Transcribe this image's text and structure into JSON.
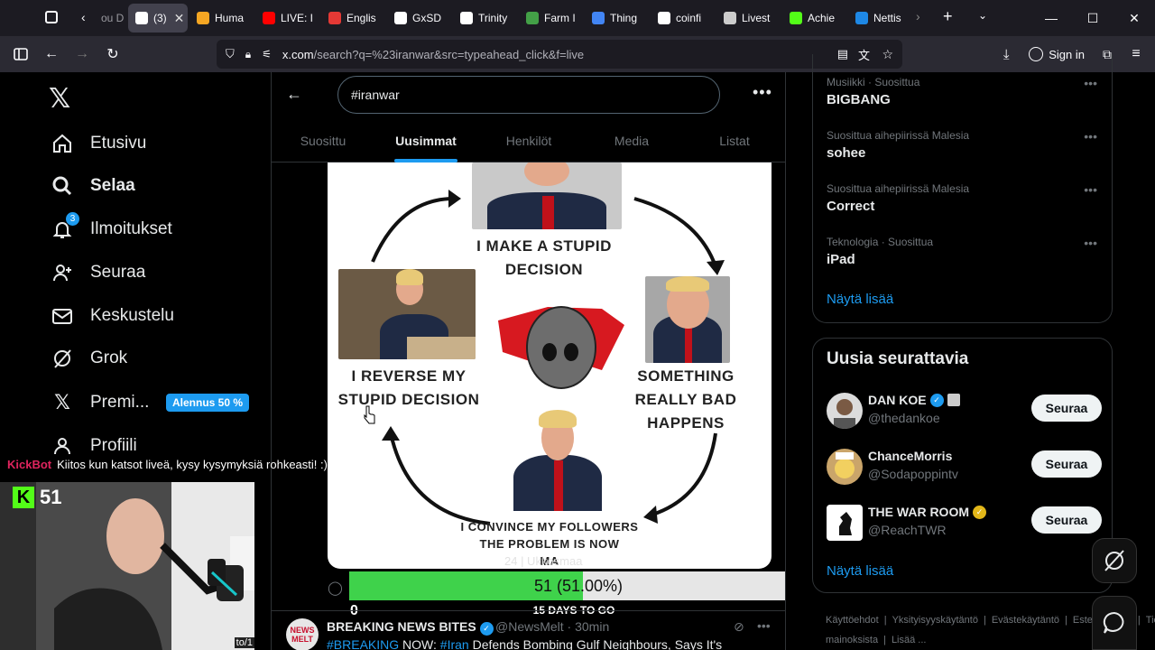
{
  "browser": {
    "tabs": [
      {
        "label": "ou D",
        "color": "#888888"
      },
      {
        "label": "(3)",
        "color": "#ffffff",
        "active": true
      },
      {
        "label": "Huma",
        "color": "#f5a623"
      },
      {
        "label": "LIVE: I",
        "color": "#ff0000"
      },
      {
        "label": "Englis",
        "color": "#e53935"
      },
      {
        "label": "GxSD",
        "color": "#ffffff"
      },
      {
        "label": "Trinity",
        "color": "#ffffff"
      },
      {
        "label": "Farm I",
        "color": "#43a047"
      },
      {
        "label": "Thing",
        "color": "#4285f4"
      },
      {
        "label": "coinfi",
        "color": "#ffffff"
      },
      {
        "label": "Livest",
        "color": "#cccccc"
      },
      {
        "label": "Achie",
        "color": "#53fc18"
      },
      {
        "label": "Nettis",
        "color": "#1e88e5"
      }
    ],
    "url_main": "x.com",
    "url_path": "/search?q=%23iranwar&src=typeahead_click&f=live",
    "signin": "Sign in"
  },
  "leftnav": {
    "items": [
      {
        "label": "Etusivu",
        "icon": "home-icon"
      },
      {
        "label": "Selaa",
        "icon": "search-icon",
        "bold": true
      },
      {
        "label": "Ilmoitukset",
        "icon": "bell-icon",
        "badge": "3"
      },
      {
        "label": "Seuraa",
        "icon": "person-add-icon"
      },
      {
        "label": "Keskustelu",
        "icon": "mail-icon"
      },
      {
        "label": "Grok",
        "icon": "grok-icon"
      },
      {
        "label": "Premi...",
        "icon": "x-logo-icon"
      },
      {
        "label": "Profiili",
        "icon": "person-icon"
      }
    ],
    "promo": "Alennus 50 %"
  },
  "search": {
    "query": "#iranwar",
    "tabs": [
      "Suosittu",
      "Uusimmat",
      "Henkilöt",
      "Media",
      "Listat"
    ],
    "active_tab": 1
  },
  "meme": {
    "top": "I MAKE A STUPID\nDECISION",
    "right": "SOMETHING\nREALLY BAD\nHAPPENS",
    "bottom": "I CONVINCE MY FOLLOWERS\nTHE PROBLEM IS NOW\nMA",
    "left": "I REVERSE MY\nSTUPID DECISION"
  },
  "overlay_caption": "24 | Ukkosmaa",
  "poll": {
    "text": "51 (51.00%)",
    "fraction": 0.51,
    "min": "0",
    "max": "100",
    "countdown": "15 DAYS TO GO",
    "fill_color": "#3fd24b"
  },
  "tweet2": {
    "avatar_text": "NEWS\nMELT",
    "name": "BREAKING NEWS BITES",
    "handle": "@NewsMelt · 30min",
    "tag1": "#BREAKING",
    "mid": " NOW: ",
    "tag2": "#Iran",
    "rest": " Defends Bombing Gulf Neighbours, Says It's"
  },
  "trends": [
    {
      "category": "Musiikki · Suosittua",
      "name": "BIGBANG"
    },
    {
      "category": "Suosittua aihepiirissä Malesia",
      "name": "sohee"
    },
    {
      "category": "Suosittua aihepiirissä Malesia",
      "name": "Correct"
    },
    {
      "category": "Teknologia · Suosittua",
      "name": "iPad"
    }
  ],
  "show_more": "Näytä lisää",
  "who_to_follow": {
    "title": "Uusia seurattavia",
    "users": [
      {
        "name": "DAN KOE",
        "handle": "@thedankoe",
        "verified_color": "#1d9bf0"
      },
      {
        "name": "ChanceMorris",
        "handle": "@Sodapoppintv"
      },
      {
        "name": "THE WAR ROOM",
        "handle": "@ReachTWR",
        "verified_color": "#e2b719"
      }
    ],
    "follow_label": "Seuraa",
    "show_more": "Näytä lisää"
  },
  "footer": {
    "links": [
      "Käyttöehdot",
      "|",
      "Yksityisyyskäytäntö",
      "|",
      "Evästekäytäntö",
      "|",
      "Esteettömyys",
      "|",
      "Tietoa mainoksista",
      "|",
      "Lisää ..."
    ]
  },
  "stream": {
    "chat_user": "KickBot",
    "chat_msg": "Kiitos kun katsot liveä, kysy kysymyksiä rohkeasti! :)",
    "viewers": "51",
    "kick_letter": "K",
    "corner_text": "to/1"
  },
  "colors": {
    "accent": "#1d9bf0",
    "kick": "#53fc18"
  }
}
